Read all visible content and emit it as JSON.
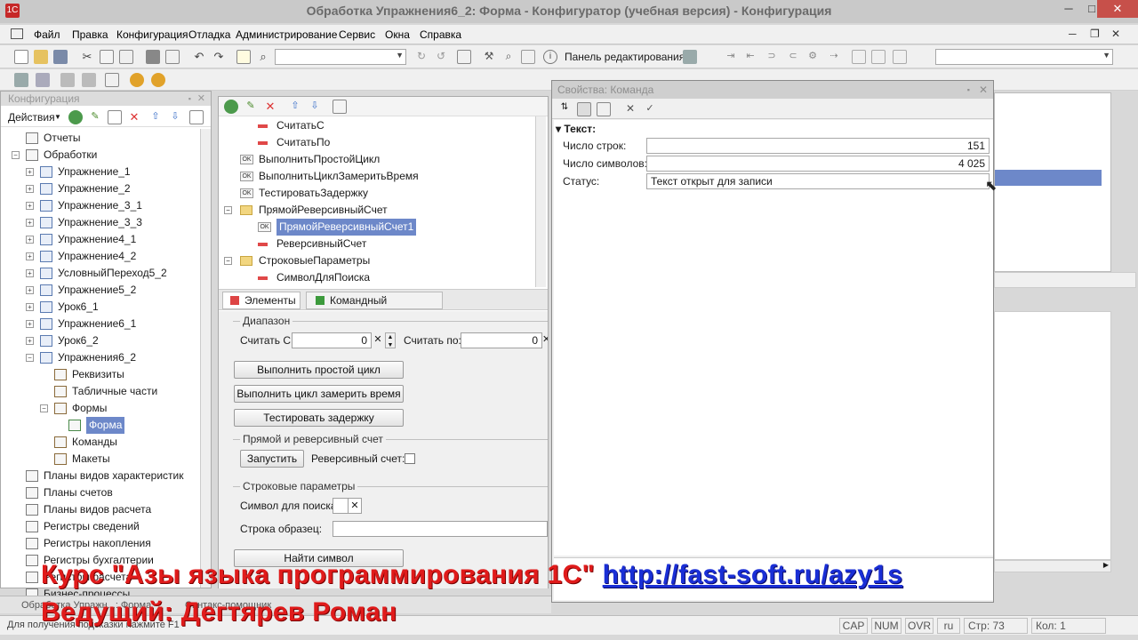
{
  "window": {
    "title": "Обработка Упражнения6_2: Форма - Конфигуратор (учебная версия) - Конфигурация",
    "minimize": "─",
    "maximize": "□",
    "close": "✕"
  },
  "menu": [
    "Файл",
    "Правка",
    "Конфигурация",
    "Отладка",
    "Администрирование",
    "Сервис",
    "Окна",
    "Справка"
  ],
  "mdi_controls": [
    "─",
    "❐",
    "✕"
  ],
  "toolbar": {
    "edit_panel_label": "Панель редактирования",
    "search_value": ""
  },
  "config_panel": {
    "title": "Конфигурация",
    "actions_label": "Действия",
    "tree": [
      {
        "label": "Отчеты",
        "level": 0,
        "expander": ""
      },
      {
        "label": "Обработки",
        "level": 0,
        "expander": "−"
      },
      {
        "label": "Упражнение_1",
        "level": 1,
        "expander": "+"
      },
      {
        "label": "Упражнение_2",
        "level": 1,
        "expander": "+"
      },
      {
        "label": "Упражнение_3_1",
        "level": 1,
        "expander": "+"
      },
      {
        "label": "Упражнение_3_3",
        "level": 1,
        "expander": "+"
      },
      {
        "label": "Упражнение4_1",
        "level": 1,
        "expander": "+"
      },
      {
        "label": "Упражнение4_2",
        "level": 1,
        "expander": "+"
      },
      {
        "label": "УсловныйПереход5_2",
        "level": 1,
        "expander": "+"
      },
      {
        "label": "Упражнение5_2",
        "level": 1,
        "expander": "+"
      },
      {
        "label": "Урок6_1",
        "level": 1,
        "expander": "+"
      },
      {
        "label": "Упражнение6_1",
        "level": 1,
        "expander": "+"
      },
      {
        "label": "Урок6_2",
        "level": 1,
        "expander": "+"
      },
      {
        "label": "Упражнения6_2",
        "level": 1,
        "expander": "−"
      },
      {
        "label": "Реквизиты",
        "level": 2,
        "expander": ""
      },
      {
        "label": "Табличные части",
        "level": 2,
        "expander": ""
      },
      {
        "label": "Формы",
        "level": 2,
        "expander": "−"
      },
      {
        "label": "Форма",
        "level": 3,
        "expander": "",
        "selected": true
      },
      {
        "label": "Команды",
        "level": 2,
        "expander": ""
      },
      {
        "label": "Макеты",
        "level": 2,
        "expander": ""
      },
      {
        "label": "Планы видов характеристик",
        "level": 0,
        "expander": ""
      },
      {
        "label": "Планы счетов",
        "level": 0,
        "expander": ""
      },
      {
        "label": "Планы видов расчета",
        "level": 0,
        "expander": ""
      },
      {
        "label": "Регистры сведений",
        "level": 0,
        "expander": ""
      },
      {
        "label": "Регистры накопления",
        "level": 0,
        "expander": ""
      },
      {
        "label": "Регистры бухгалтерии",
        "level": 0,
        "expander": ""
      },
      {
        "label": "Регистры расчета",
        "level": 0,
        "expander": ""
      },
      {
        "label": "Бизнес-процессы",
        "level": 0,
        "expander": ""
      }
    ]
  },
  "elements_tree": [
    {
      "label": "СчитатьС",
      "icon": "field",
      "indent": 1
    },
    {
      "label": "СчитатьПо",
      "icon": "field",
      "indent": 1
    },
    {
      "label": "ВыполнитьПростойЦикл",
      "icon": "ok",
      "indent": 0
    },
    {
      "label": "ВыполнитьЦиклЗамеритьВремя",
      "icon": "ok",
      "indent": 0
    },
    {
      "label": "ТестироватьЗадержку",
      "icon": "ok",
      "indent": 0
    },
    {
      "label": "ПрямойРеверсивныйСчет",
      "icon": "folder",
      "indent": 0
    },
    {
      "label": "ПрямойРеверсивныйСчет1",
      "icon": "ok",
      "indent": 1,
      "selected": true
    },
    {
      "label": "РеверсивныйСчет",
      "icon": "field",
      "indent": 1
    },
    {
      "label": "СтроковыеПараметры",
      "icon": "folder",
      "indent": 0
    },
    {
      "label": "СимволДляПоиска",
      "icon": "field",
      "indent": 1
    }
  ],
  "form_tabs": [
    "Элементы",
    "Командный интерфейс"
  ],
  "form_preview": {
    "range_group": "Диапазон",
    "from_label": "Считать С:",
    "from_value": "0",
    "to_label": "Считать по:",
    "to_value": "0",
    "btn_simple": "Выполнить простой цикл",
    "btn_timed": "Выполнить цикл замерить время",
    "btn_delay": "Тестировать задержку",
    "count_group": "Прямой и реверсивный счет",
    "btn_run": "Запустить",
    "reverse_label": "Реверсивный счет:",
    "string_group": "Строковые параметры",
    "search_char_label": "Символ для поиска:",
    "sample_label": "Строка образец:",
    "btn_find": "Найти символ"
  },
  "properties": {
    "title": "Свойства: Команда",
    "section": "Текст:",
    "rows": [
      {
        "label": "Число строк:",
        "value": "151",
        "align": "right"
      },
      {
        "label": "Число символов:",
        "value": "4 025",
        "align": "right"
      },
      {
        "label": "Статус:",
        "value": "Текст открыт для записи",
        "align": "left"
      }
    ]
  },
  "taskbar": [
    "Обработка Упражн...: Форма",
    "Синтакс-помощник"
  ],
  "statusbar": {
    "hint": "Для получения подсказки нажмите F1",
    "cap": "CAP",
    "num": "NUM",
    "ovr": "OVR",
    "lang": "ru",
    "line": "Стр: 73",
    "col": "Кол: 1"
  },
  "overlay": {
    "course": "Курс \"Азы языка программирования 1С\"",
    "link": "http://fast-soft.ru/azy1s",
    "host": "Ведущий: Дегтярев Роман"
  },
  "colors": {
    "selection": "#6d88c9",
    "overlay_red": "#e01b1b",
    "overlay_link": "#1a2fd6"
  }
}
